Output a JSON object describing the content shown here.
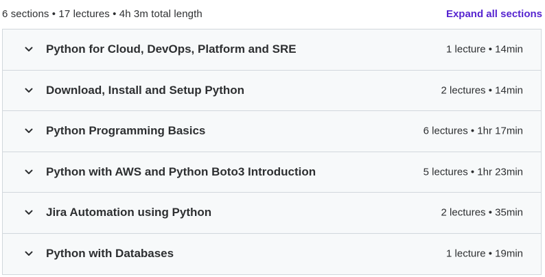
{
  "summary": "6 sections • 17 lectures • 4h 3m total length",
  "expand_all_label": "Expand all sections",
  "colors": {
    "accent": "#5624d0",
    "section_bg": "#f7f9fa",
    "border": "#d1d7dc",
    "text": "#2d2f31"
  },
  "sections": [
    {
      "title": "Python for Cloud, DevOps, Platform and SRE",
      "meta": "1 lecture • 14min",
      "icon": "chevron-down-icon"
    },
    {
      "title": "Download, Install and Setup Python",
      "meta": "2 lectures • 14min",
      "icon": "chevron-down-icon"
    },
    {
      "title": "Python Programming Basics",
      "meta": "6 lectures • 1hr 17min",
      "icon": "chevron-down-icon"
    },
    {
      "title": "Python with AWS and Python Boto3 Introduction",
      "meta": "5 lectures • 1hr 23min",
      "icon": "chevron-down-icon"
    },
    {
      "title": "Jira Automation using Python",
      "meta": "2 lectures • 35min",
      "icon": "chevron-down-icon"
    },
    {
      "title": "Python with Databases",
      "meta": "1 lecture • 19min",
      "icon": "chevron-down-icon"
    }
  ]
}
